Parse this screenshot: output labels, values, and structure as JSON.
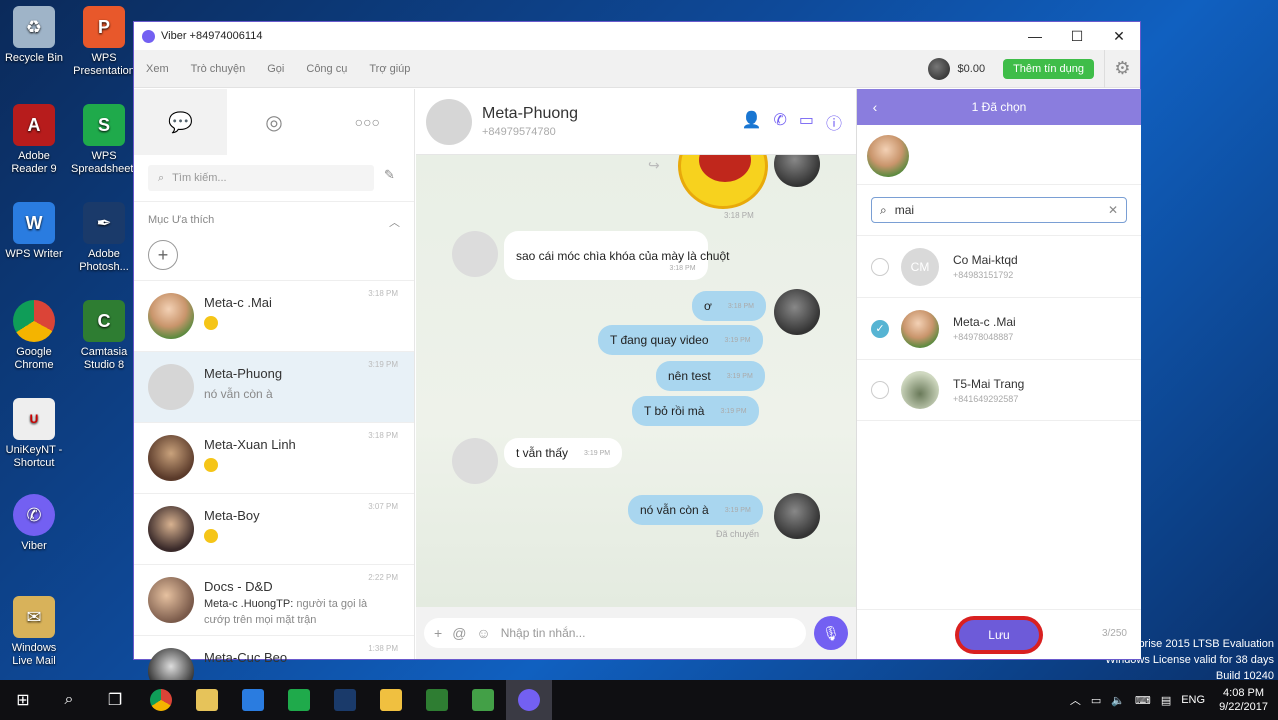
{
  "desktop": {
    "icons": [
      {
        "label": "Recycle Bin"
      },
      {
        "label": "WPS Presentation"
      },
      {
        "label": "Adobe Reader 9"
      },
      {
        "label": "WPS Spreadsheets"
      },
      {
        "label": "WPS Writer"
      },
      {
        "label": "Adobe Photosh..."
      },
      {
        "label": "Google Chrome"
      },
      {
        "label": "Camtasia Studio 8"
      },
      {
        "label": "UniKeyNT - Shortcut"
      },
      {
        "label": "Viber"
      },
      {
        "label": "Windows Live Mail"
      }
    ],
    "watermark": {
      "line1": "rprise 2015 LTSB Evaluation",
      "line2": "Windows License valid for 38 days",
      "line3": "Build 10240"
    }
  },
  "window": {
    "title": "Viber +84974006114",
    "menu": [
      "Xem",
      "Trò chuyện",
      "Gọi",
      "Công cụ",
      "Trợ giúp"
    ],
    "balance": "$0.00",
    "credit_button": "Thêm tín dụng"
  },
  "left": {
    "search_placeholder": "Tìm kiếm...",
    "favorites_title": "Mục Ưa thích",
    "contacts": [
      {
        "name": "Meta-c .Mai",
        "preview": "",
        "time": "3:18 PM"
      },
      {
        "name": "Meta-Phuong",
        "preview": "nó vẫn còn à",
        "time": "3:19 PM"
      },
      {
        "name": "Meta-Xuan Linh",
        "preview": "",
        "time": "3:18 PM"
      },
      {
        "name": "Meta-Boy",
        "preview": "",
        "time": "3:07 PM"
      },
      {
        "name": "Docs - D&D",
        "sender": "Meta-c .HuongTP:",
        "preview": "người ta gọi là cướp trên mọi mặt trận",
        "time": "2:22 PM"
      },
      {
        "name": "Meta-Cuc Beo",
        "preview": "",
        "time": "1:38 PM"
      }
    ]
  },
  "chat": {
    "name": "Meta-Phuong",
    "phone": "+84979574780",
    "messages": [
      {
        "dir": "in",
        "text": "sao cái móc chìa khóa của mày là chuột",
        "time": "3:18 PM"
      },
      {
        "dir": "out",
        "text": "ơ",
        "time": "3:18 PM"
      },
      {
        "dir": "out",
        "text": "T đang quay video",
        "time": "3:19 PM"
      },
      {
        "dir": "out",
        "text": "nên test",
        "time": "3:19 PM"
      },
      {
        "dir": "out",
        "text": "T bỏ rồi mà",
        "time": "3:19 PM"
      },
      {
        "dir": "in",
        "text": "t vẫn thấy",
        "time": "3:19 PM"
      },
      {
        "dir": "out",
        "text": "nó vẫn còn à",
        "time": "3:19 PM"
      }
    ],
    "sticker_time": "3:18 PM",
    "delivered_label": "Đã chuyển",
    "input_placeholder": "Nhập tin nhắn..."
  },
  "forward": {
    "header": "1 Đã chọn",
    "search_value": "mai",
    "results": [
      {
        "name": "Co Mai-ktqd",
        "phone": "+84983151792",
        "initials": "CM",
        "selected": false
      },
      {
        "name": "Meta-c .Mai",
        "phone": "+84978048887",
        "initials": "",
        "selected": true
      },
      {
        "name": "T5-Mai Trang",
        "phone": "+841649292587",
        "initials": "",
        "selected": false
      }
    ],
    "save_label": "Lưu",
    "counter": "3/250"
  },
  "taskbar": {
    "language": "ENG",
    "time": "4:08 PM",
    "date": "9/22/2017"
  },
  "colors": {
    "viber_purple": "#7360f2",
    "credit_green": "#3fbd49",
    "outgoing_bubble": "#a9d6ef",
    "highlight_red": "#d92020"
  }
}
